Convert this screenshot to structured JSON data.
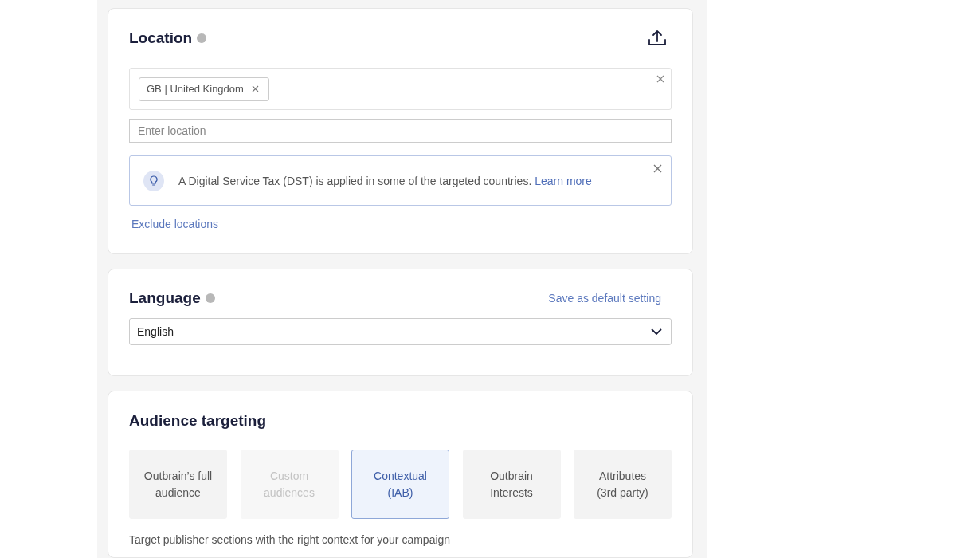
{
  "location": {
    "title": "Location",
    "tags": [
      {
        "label": "GB | United Kingdom"
      }
    ],
    "input": {
      "placeholder": "Enter location"
    },
    "notice": {
      "text": "A Digital Service Tax (DST) is applied in some of the targeted countries.",
      "link": "Learn more"
    },
    "exclude_link": "Exclude locations"
  },
  "language": {
    "title": "Language",
    "save_link": "Save as default setting",
    "value": "English"
  },
  "audience": {
    "title": "Audience targeting",
    "options": [
      {
        "label": "Outbrain’s full\naudience",
        "selected": false,
        "disabled": false
      },
      {
        "label": "Custom\naudiences",
        "selected": false,
        "disabled": true
      },
      {
        "label": "Contextual\n(IAB)",
        "selected": true,
        "disabled": false
      },
      {
        "label": "Outbrain\nInterests",
        "selected": false,
        "disabled": false
      },
      {
        "label": "Attributes\n(3rd party)",
        "selected": false,
        "disabled": false
      }
    ],
    "description": "Target publisher sections with the right context for your campaign"
  }
}
